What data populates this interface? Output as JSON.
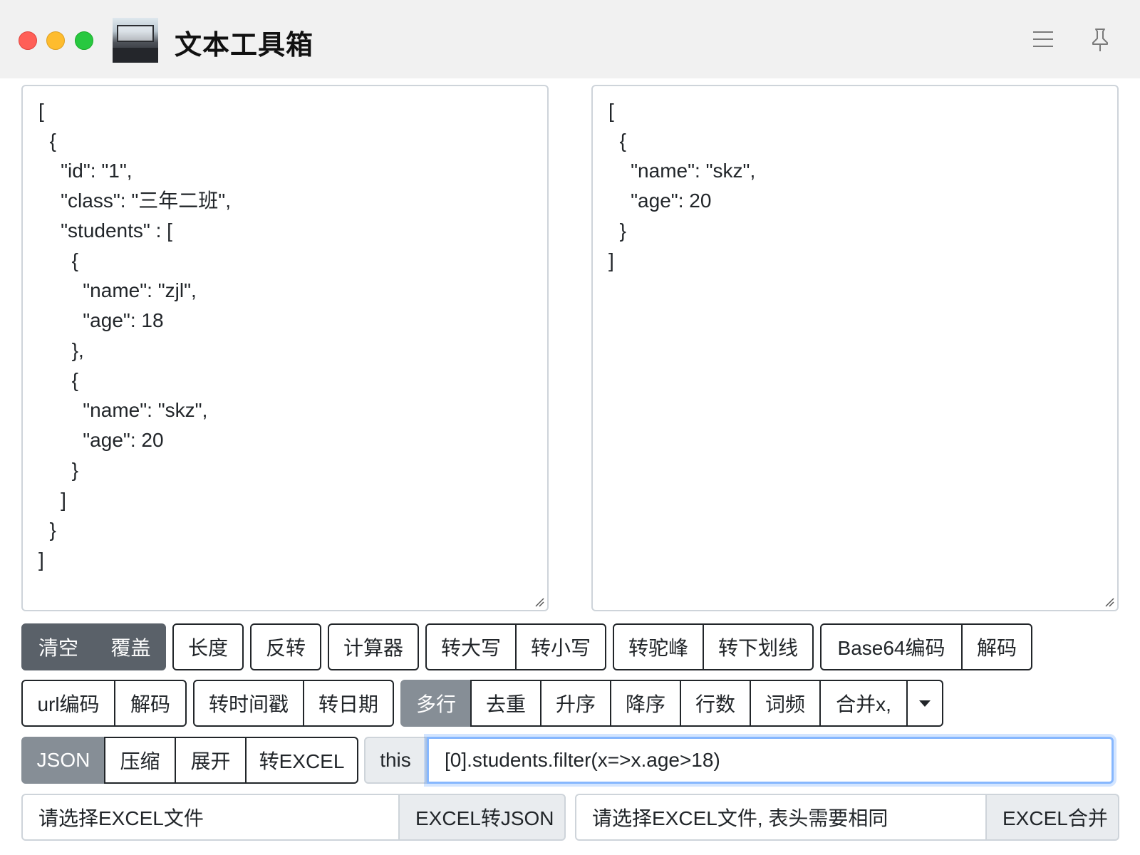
{
  "window": {
    "title": "文本工具箱"
  },
  "editor": {
    "left_text": "[\n  {\n    \"id\": \"1\",\n    \"class\": \"三年二班\",\n    \"students\" : [\n      {\n        \"name\": \"zjl\",\n        \"age\": 18\n      },\n      {\n        \"name\": \"skz\",\n        \"age\": 20\n      }\n    ]\n  }\n]",
    "right_text": "[\n  {\n    \"name\": \"skz\",\n    \"age\": 20\n  }\n]"
  },
  "toolbar1": {
    "clear": "清空",
    "overwrite": "覆盖",
    "length": "长度",
    "reverse": "反转",
    "calculator": "计算器",
    "upper": "转大写",
    "lower": "转小写",
    "camel": "转驼峰",
    "underscore": "转下划线",
    "base64_encode": "Base64编码",
    "base64_decode": "解码"
  },
  "toolbar2": {
    "url_encode": "url编码",
    "url_decode": "解码",
    "to_timestamp": "转时间戳",
    "to_date": "转日期",
    "multiline": "多行",
    "dedupe": "去重",
    "sort_asc": "升序",
    "sort_desc": "降序",
    "line_count": "行数",
    "word_freq": "词频",
    "merge": "合并x,"
  },
  "toolbar3": {
    "json": "JSON",
    "compress": "压缩",
    "expand": "展开",
    "to_excel": "转EXCEL",
    "this_label": "this",
    "expression": "[0].students.filter(x=>x.age>18)"
  },
  "files": {
    "excel_placeholder": "请选择EXCEL文件",
    "excel_to_json": "EXCEL转JSON",
    "merge_placeholder": "请选择EXCEL文件, 表头需要相同",
    "excel_merge": "EXCEL合并"
  },
  "colors": {
    "active_button": "#5a6169",
    "toggle_button": "#868e96",
    "focus_ring": "#86b7fe"
  }
}
